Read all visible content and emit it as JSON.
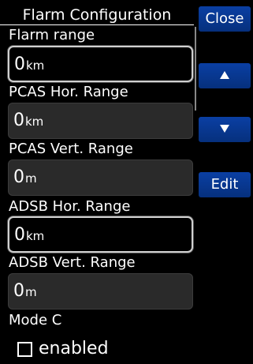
{
  "title": "Flarm Configuration",
  "buttons": {
    "close": "Close",
    "up_icon": "arrow-up-icon",
    "down_icon": "arrow-down-icon",
    "edit": "Edit"
  },
  "fields": [
    {
      "label": "Flarm range",
      "value": "0",
      "unit": "km"
    },
    {
      "label": "PCAS Hor. Range",
      "value": "0",
      "unit": "km"
    },
    {
      "label": "PCAS Vert. Range",
      "value": "0",
      "unit": "m"
    },
    {
      "label": "ADSB Hor. Range",
      "value": "0",
      "unit": "km"
    },
    {
      "label": "ADSB Vert. Range",
      "value": "0",
      "unit": "m"
    }
  ],
  "mode_c": {
    "label": "Mode C",
    "checkbox_label": "enabled",
    "checked": false
  }
}
